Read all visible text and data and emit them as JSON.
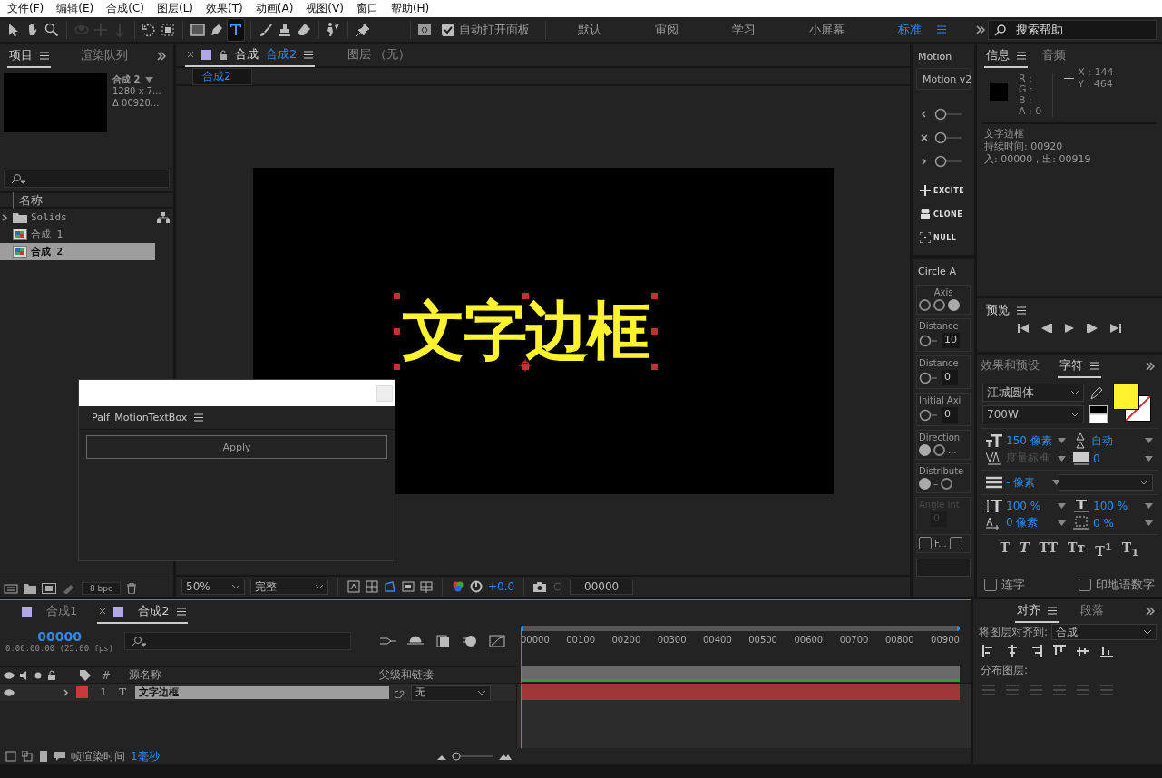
{
  "menu": [
    "文件(F)",
    "编辑(E)",
    "合成(C)",
    "图层(L)",
    "效果(T)",
    "动画(A)",
    "视图(V)",
    "窗口",
    "帮助(H)"
  ],
  "toolbar": {
    "tools": [
      {
        "selected": false,
        "disabled": false
      },
      {
        "selected": false,
        "disabled": false
      },
      {
        "selected": false,
        "disabled": false
      },
      {
        "selected": false,
        "disabled": true
      },
      {
        "selected": false,
        "disabled": true
      },
      {
        "selected": false,
        "disabled": true
      },
      {
        "selected": false,
        "disabled": false
      },
      {
        "selected": false,
        "disabled": false
      },
      {
        "selected": false,
        "disabled": false
      },
      {
        "selected": false,
        "disabled": false
      },
      {
        "selected": true,
        "disabled": false
      },
      {
        "selected": false,
        "disabled": false
      },
      {
        "selected": false,
        "disabled": false
      },
      {
        "selected": false,
        "disabled": false
      },
      {
        "selected": false,
        "disabled": false
      },
      {
        "selected": false,
        "disabled": false
      }
    ],
    "auto_open_panel": {
      "label": "自动打开面板",
      "checked": true
    },
    "workspaces": [
      {
        "label": "默认",
        "selected": false
      },
      {
        "label": "审阅",
        "selected": false
      },
      {
        "label": "学习",
        "selected": false
      },
      {
        "label": "小屏幕",
        "selected": false
      },
      {
        "label": "标准",
        "selected": true
      }
    ],
    "search": {
      "placeholder": "搜索帮助"
    }
  },
  "project_panel": {
    "tabs": [
      {
        "label": "项目",
        "selected": true
      },
      {
        "label": "渲染队列",
        "selected": false
      }
    ],
    "preview": {
      "name": "合成 2",
      "size": "1280 x 7...",
      "duration": "Δ 00920..."
    },
    "column": "名称",
    "items": [
      {
        "name": "Solids",
        "kind": "folder",
        "selected": false
      },
      {
        "name": "合成 1",
        "kind": "comp",
        "selected": false
      },
      {
        "name": "合成 2",
        "kind": "comp",
        "selected": true
      }
    ],
    "bit_depth": "8 bpc"
  },
  "composition_panel": {
    "tabs": [
      {
        "label": "合成",
        "name": "合成2",
        "selected": true
      },
      {
        "label": "图层 （无）",
        "selected": false
      }
    ],
    "breadcrumb": "合成2",
    "canvas_text": "文字边框",
    "zoom": "50%",
    "resolution": "完整",
    "exposure": "+0.0",
    "timecode": "00000"
  },
  "motion_panel": {
    "tab": "Motion",
    "title": "Motion v2",
    "buttons": [
      "EXCITE",
      "CLONE",
      "NULL"
    ]
  },
  "circle_panel": {
    "tab": "Circle A",
    "axis": {
      "label": "Axis",
      "options": [
        {
          "selected": false
        },
        {
          "selected": false
        },
        {
          "selected": true
        }
      ]
    },
    "fields": [
      {
        "label": "Distance",
        "value": "10"
      },
      {
        "label": "Distance",
        "value": "0"
      },
      {
        "label": "Initial Axi",
        "value": "0"
      }
    ],
    "direction": {
      "label": "Direction",
      "options": [
        {
          "selected": true
        },
        {
          "selected": false,
          "label": "..."
        }
      ]
    },
    "distribute": {
      "label": "Distribute",
      "options": [
        {
          "selected": true,
          "label": "–"
        },
        {
          "selected": false
        }
      ]
    },
    "angle": {
      "label": "Angle int",
      "value": "0",
      "disabled": true
    },
    "checks": [
      {
        "label": "F...",
        "checked": false
      },
      {
        "checked": false
      }
    ]
  },
  "info_panel": {
    "tabs": [
      {
        "label": "信息",
        "selected": true
      },
      {
        "label": "音频",
        "selected": false
      }
    ],
    "channels": [
      {
        "label": "R :"
      },
      {
        "label": "G :"
      },
      {
        "label": "B :"
      },
      {
        "label": "A :",
        "value": "0"
      }
    ],
    "coords": [
      "X : 144",
      "Y : 464"
    ],
    "details": [
      "文字边框",
      "持续时间: 00920",
      "入: 00000，出: 00919"
    ]
  },
  "preview_panel": {
    "title": "预览"
  },
  "character_panel": {
    "tabs": [
      {
        "label": "效果和预设",
        "selected": false
      },
      {
        "label": "字符",
        "selected": true
      }
    ],
    "font": "江城圆体",
    "style": "700W",
    "size": "150 像素",
    "leading": "自动",
    "kerning": "度量标准",
    "tracking": "0",
    "stroke_width": "- 像素",
    "vertical_scale": "100 %",
    "horizontal_scale": "100 %",
    "baseline_shift": "0 像素",
    "tsume": "0 %",
    "styles": [
      "T",
      "T",
      "TT",
      "Tᴛ",
      "T$^{1}$",
      "T$_{1}$"
    ],
    "checks": [
      {
        "label": "连字",
        "checked": false
      },
      {
        "label": "印地语数字",
        "checked": false
      }
    ]
  },
  "timeline": {
    "tabs": [
      {
        "label": "合成1",
        "selected": false
      },
      {
        "label": "合成2",
        "selected": true
      }
    ],
    "timecode": "00000",
    "fps": "0:00:00:00 (25.00 fps)",
    "columns": [
      "#",
      "源名称",
      "父级和链接"
    ],
    "layers": [
      {
        "number": "1",
        "type": "T",
        "name": "文字边框",
        "parent": "无",
        "color": "#c83a3a",
        "selected": true
      }
    ],
    "ticks": [
      "00000",
      "00100",
      "00200",
      "00300",
      "00400",
      "00500",
      "00600",
      "00700",
      "00800",
      "00900"
    ]
  },
  "align_panel": {
    "tabs": [
      {
        "label": "对齐",
        "selected": true
      },
      {
        "label": "段落",
        "selected": false
      }
    ],
    "align_to_label": "将图层对齐到:",
    "align_to": "合成",
    "distribute_label": "分布图层:"
  },
  "status_bar": {
    "label": "帧渲染时间",
    "value": "1毫秒",
    "zoom": {
      "level": 0
    }
  },
  "floating_window": {
    "title": "Palf_MotionTextBox",
    "button": "Apply"
  }
}
